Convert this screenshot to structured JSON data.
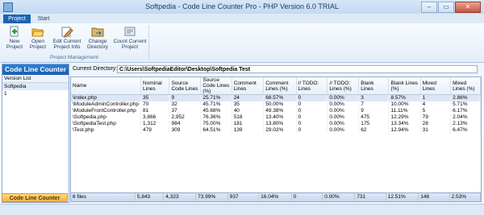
{
  "window": {
    "title": "Softpedia - Code Line Counter Pro - PHP Version 6.0 TRIAL",
    "controls": [
      "–",
      "▭",
      "✕"
    ]
  },
  "tabs": [
    {
      "label": "Project"
    },
    {
      "label": "Start"
    }
  ],
  "ribbon": {
    "buttons": [
      {
        "label": "New Project",
        "icon": "new-project-icon"
      },
      {
        "label": "Open Project",
        "icon": "open-project-icon"
      },
      {
        "label": "Edit Current Project Info",
        "icon": "edit-project-icon"
      },
      {
        "label": "Change Directory",
        "icon": "folder-icon"
      },
      {
        "label": "Count Current Project",
        "icon": "count-icon"
      }
    ],
    "group_label": "Project Management"
  },
  "left_panel": {
    "title": "Code Line Counter",
    "list_header": "Version List",
    "items": [
      "Softpedia",
      "1"
    ],
    "bottom_button": "Code Line Counter"
  },
  "directory": {
    "label": "Current Directory:",
    "value": "C:\\Users\\SoftpediaEditor\\Desktop\\Softpedia Test"
  },
  "table": {
    "columns": [
      "Name",
      "Nominal Lines",
      "Source Code Lines",
      "Source Code Lines (%)",
      "Comment Lines",
      "Comment Lines (%)",
      "// TODO: Lines",
      "// TODO: Lines (%)",
      "Blank Lines",
      "Blank Lines (%)",
      "Mixed Lines",
      "Mixed Lines (%)"
    ],
    "rows": [
      [
        "\\index.php",
        "35",
        "9",
        "25.71%",
        "24",
        "68.57%",
        "0",
        "0.00%",
        "3",
        "8.57%",
        "1",
        "2.86%"
      ],
      [
        "\\ModuleAdminController.php",
        "70",
        "32",
        "45.71%",
        "35",
        "50.00%",
        "0",
        "0.00%",
        "7",
        "10.00%",
        "4",
        "5.71%"
      ],
      [
        "\\ModuleFrontController.php",
        "81",
        "37",
        "45.68%",
        "40",
        "49.38%",
        "0",
        "0.00%",
        "9",
        "11.11%",
        "5",
        "6.17%"
      ],
      [
        "\\Softpedia.php",
        "3,866",
        "2,952",
        "76.36%",
        "518",
        "13.40%",
        "0",
        "0.00%",
        "475",
        "12.29%",
        "79",
        "2.04%"
      ],
      [
        "\\SoftpediaTest.php",
        "1,312",
        "984",
        "75.00%",
        "181",
        "13.80%",
        "0",
        "0.00%",
        "175",
        "13.34%",
        "28",
        "2.13%"
      ],
      [
        "\\Test.php",
        "479",
        "309",
        "64.51%",
        "139",
        "29.02%",
        "0",
        "0.00%",
        "62",
        "12.94%",
        "31",
        "6.47%"
      ]
    ],
    "footer": [
      "6 files",
      "5,843",
      "4,323",
      "73.99%",
      "937",
      "16.04%",
      "0",
      "0.00%",
      "731",
      "12.51%",
      "148",
      "2.53%"
    ]
  }
}
